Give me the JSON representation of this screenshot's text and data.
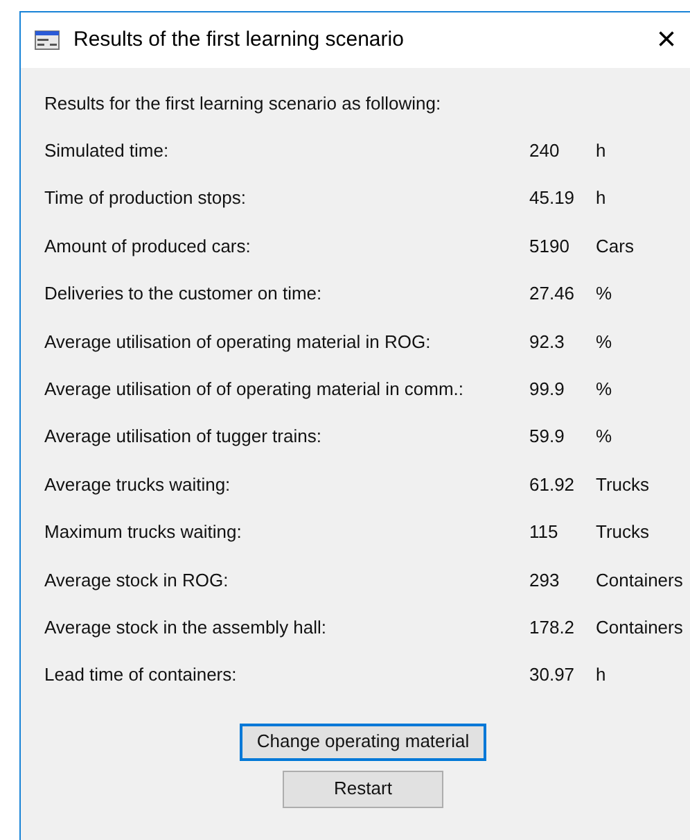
{
  "window": {
    "title": "Results of the first learning scenario",
    "close": "×"
  },
  "intro": "Results for the first learning scenario as following:",
  "results": [
    {
      "label": "Simulated time:",
      "value": "240",
      "unit": "h"
    },
    {
      "label": "Time of production stops:",
      "value": "45.19",
      "unit": "h"
    },
    {
      "label": "Amount of produced cars:",
      "value": "5190",
      "unit": "Cars"
    },
    {
      "label": "Deliveries to the customer on time:",
      "value": "27.46",
      "unit": "%"
    },
    {
      "label": "Average utilisation of operating material in ROG:",
      "value": "92.3",
      "unit": "%"
    },
    {
      "label": "Average utilisation of of operating material in comm.:",
      "value": "99.9",
      "unit": "%"
    },
    {
      "label": "Average utilisation of tugger trains:",
      "value": "59.9",
      "unit": "%"
    },
    {
      "label": "Average trucks waiting:",
      "value": "61.92",
      "unit": "Trucks"
    },
    {
      "label": "Maximum trucks waiting:",
      "value": "115",
      "unit": "Trucks"
    },
    {
      "label": "Average stock in ROG:",
      "value": "293",
      "unit": "Containers"
    },
    {
      "label": "Average stock in the assembly hall:",
      "value": "178.2",
      "unit": "Containers"
    },
    {
      "label": "Lead time of containers:",
      "value": "30.97",
      "unit": "h"
    }
  ],
  "buttons": [
    {
      "label": "Change operating material",
      "focused": true
    },
    {
      "label": "Restart",
      "focused": false
    }
  ]
}
